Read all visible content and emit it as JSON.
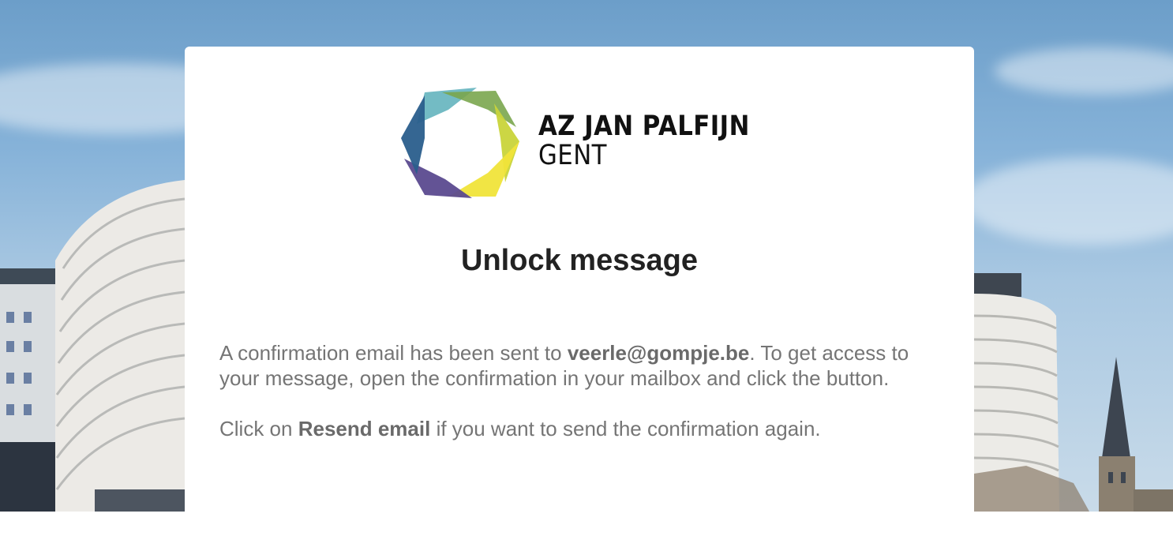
{
  "brand": {
    "name_line1": "AZ JAN PALFIJN",
    "name_line2": "GENT",
    "logo_icon": "hexagon-ribbon-logo-icon",
    "colors": [
      "#6bb7c1",
      "#7aa64e",
      "#c9d43a",
      "#f0e43a",
      "#5b4a8f",
      "#2a5e8c"
    ]
  },
  "page": {
    "title": "Unlock message",
    "confirmation": {
      "prefix": "A confirmation email has been sent to ",
      "email": "veerle@gompje.be",
      "suffix": ". To get access to your message, open the confirmation in your mailbox and click the button."
    },
    "resend": {
      "prefix": "Click on ",
      "link_label": "Resend email",
      "suffix": " if you want to send the confirmation again."
    }
  }
}
